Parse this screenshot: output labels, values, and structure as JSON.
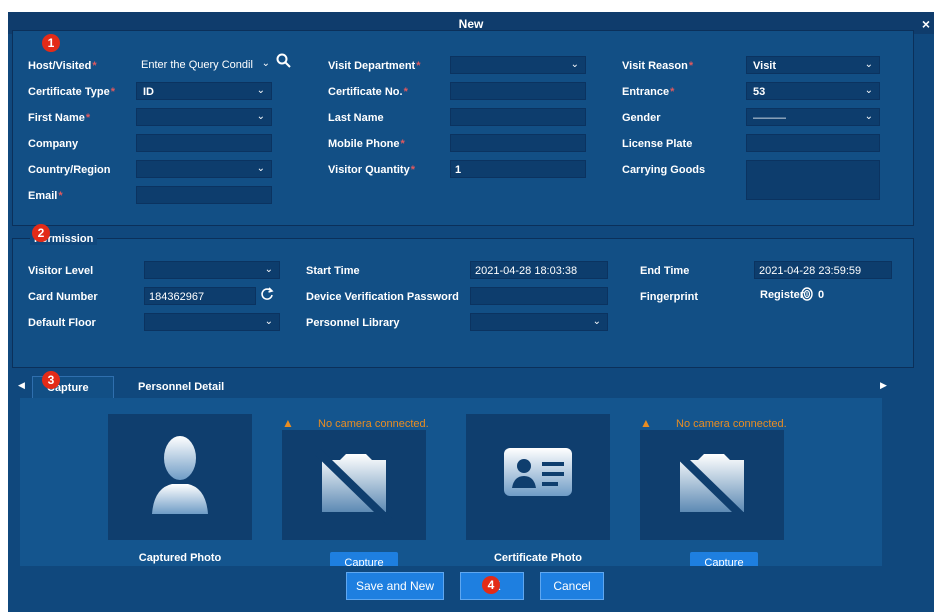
{
  "dialog": {
    "title": "New",
    "close_icon": "close-icon"
  },
  "host": {
    "host_visited": {
      "label": "Host/Visited",
      "value": "Enter the Query Condil",
      "required": true
    },
    "visit_department": {
      "label": "Visit Department",
      "value": "",
      "required": true
    },
    "visit_reason": {
      "label": "Visit Reason",
      "value": "Visit",
      "required": true
    },
    "certificate_type": {
      "label": "Certificate Type",
      "value": "ID",
      "required": true
    },
    "certificate_no": {
      "label": "Certificate No.",
      "value": "",
      "required": true
    },
    "entrance": {
      "label": "Entrance",
      "value": "53",
      "required": true
    },
    "first_name": {
      "label": "First Name",
      "value": "",
      "required": true
    },
    "last_name": {
      "label": "Last Name",
      "value": ""
    },
    "gender": {
      "label": "Gender",
      "value": "———"
    },
    "company": {
      "label": "Company",
      "value": ""
    },
    "mobile_phone": {
      "label": "Mobile Phone",
      "value": "",
      "required": true
    },
    "license_plate": {
      "label": "License Plate",
      "value": ""
    },
    "country_region": {
      "label": "Country/Region",
      "value": ""
    },
    "visitor_quantity": {
      "label": "Visitor Quantity",
      "value": "1",
      "required": true
    },
    "carrying_goods": {
      "label": "Carrying Goods",
      "value": ""
    },
    "email": {
      "label": "Email",
      "value": "",
      "required": true
    }
  },
  "permission": {
    "legend": "Permission",
    "visitor_level": {
      "label": "Visitor Level",
      "value": ""
    },
    "start_time": {
      "label": "Start Time",
      "value": "2021-04-28 18:03:38"
    },
    "end_time": {
      "label": "End Time",
      "value": "2021-04-28 23:59:59"
    },
    "card_number": {
      "label": "Card Number",
      "value": "184362967"
    },
    "device_password": {
      "label": "Device Verification Password",
      "value": ""
    },
    "fingerprint": {
      "label": "Fingerprint",
      "register": "Register",
      "count": "0"
    },
    "default_floor": {
      "label": "Default Floor",
      "value": ""
    },
    "personnel_library": {
      "label": "Personnel Library",
      "value": ""
    }
  },
  "tabs": [
    {
      "label": "Capture",
      "active": true
    },
    {
      "label": "Personnel Detail",
      "active": false
    }
  ],
  "capture": {
    "captured_photo_label": "Captured Photo",
    "certificate_photo_label": "Certificate Photo",
    "no_camera": "No camera connected.",
    "capture_button": "Capture"
  },
  "footer": {
    "save_and_new": "Save and New",
    "ok": "OK",
    "cancel": "Cancel"
  },
  "badges": [
    "1",
    "2",
    "3",
    "4"
  ],
  "colors": {
    "dialog_bg": "#10487d",
    "accent_button": "#1e7fe0",
    "required": "#e0595e",
    "warning": "#e98d22",
    "badge": "#e32b18"
  }
}
